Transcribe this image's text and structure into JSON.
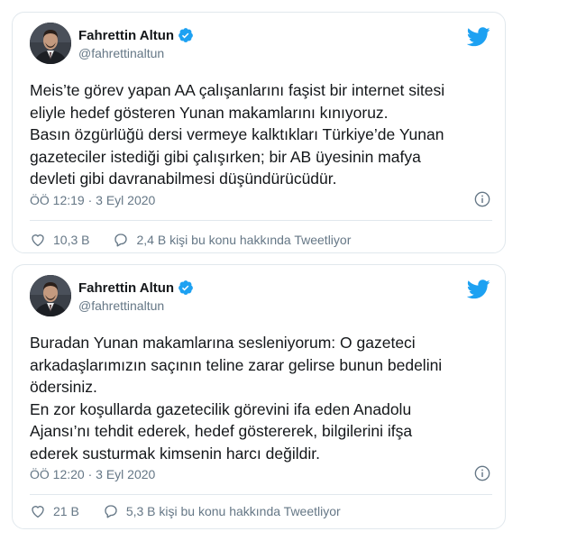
{
  "colors": {
    "verified_blue": "#1da1f2",
    "twitter_blue": "#1da1f2",
    "text": "#14171a",
    "secondary": "#657786",
    "border": "#e1e8ed"
  },
  "tweets": [
    {
      "author": {
        "name": "Fahrettin Altun",
        "handle": "@fahrettinaltun",
        "verified": true
      },
      "lines": [
        "Meis’te görev yapan AA çalışanlarını faşist bir internet sitesi",
        "eliyle hedef gösteren Yunan makamlarını kınıyoruz.",
        "Basın özgürlüğü dersi vermeye kalktıkları Türkiye’de Yunan",
        "gazeteciler istediği gibi çalışırken; bir AB üyesinin mafya",
        "devleti gibi davranabilmesi düşündürücüdür."
      ],
      "timestamp": "ÖÖ 12:19 · 3 Eyl 2020",
      "likes": "10,3 B",
      "conversation": "2,4 B kişi bu konu hakkında Tweetliyor",
      "icons": {
        "brand": "twitter-bird-icon",
        "info": "info-icon",
        "like": "heart-icon",
        "reply": "speech-bubble-icon"
      }
    },
    {
      "author": {
        "name": "Fahrettin Altun",
        "handle": "@fahrettinaltun",
        "verified": true
      },
      "lines": [
        "Buradan Yunan makamlarına sesleniyorum: O gazeteci",
        "arkadaşlarımızın saçının teline zarar gelirse bunun bedelini",
        "ödersiniz.",
        "En zor koşullarda gazetecilik görevini ifa eden Anadolu",
        "Ajansı’nı tehdit ederek, hedef göstererek, bilgilerini ifşa",
        "ederek susturmak kimsenin harcı değildir."
      ],
      "timestamp": "ÖÖ 12:20 · 3 Eyl 2020",
      "likes": "21 B",
      "conversation": "5,3 B kişi bu konu hakkında Tweetliyor",
      "icons": {
        "brand": "twitter-bird-icon",
        "info": "info-icon",
        "like": "heart-icon",
        "reply": "speech-bubble-icon"
      }
    }
  ]
}
